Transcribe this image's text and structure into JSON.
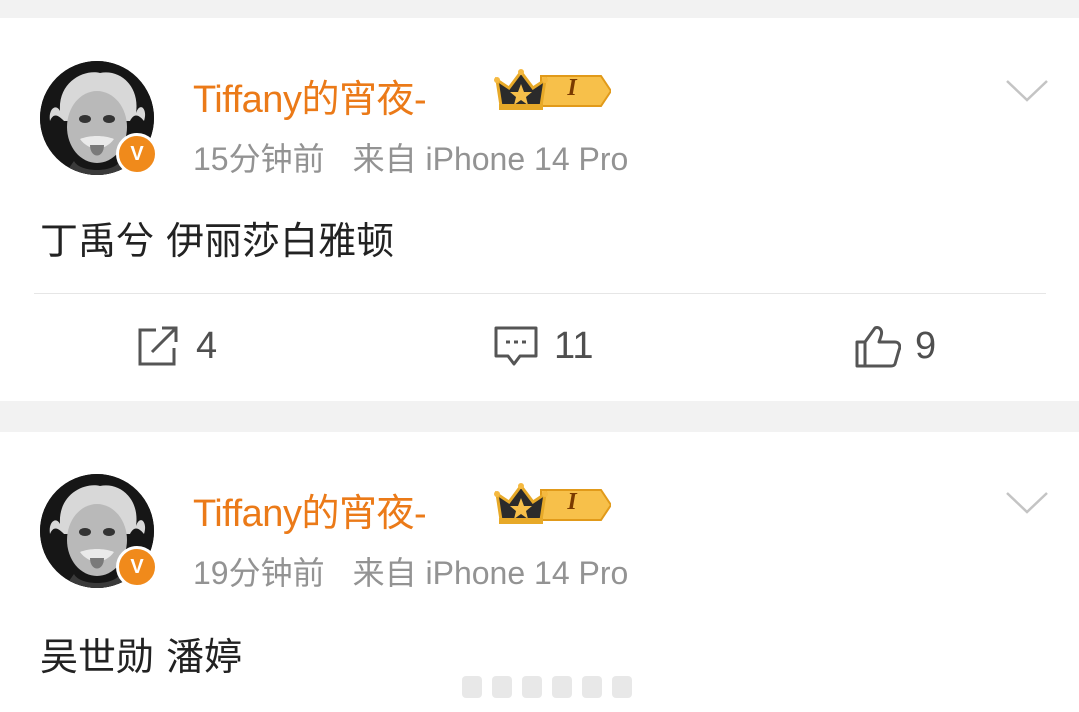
{
  "posts": [
    {
      "username": "Tiffany的宵夜-",
      "level_badge": "I",
      "verified_badge": "V",
      "time": "15分钟前",
      "source": "来自 iPhone 14 Pro",
      "content": "丁禹兮 伊丽莎白雅顿",
      "actions": {
        "repost": "4",
        "comment": "11",
        "like": "9"
      }
    },
    {
      "username": "Tiffany的宵夜-",
      "level_badge": "I",
      "verified_badge": "V",
      "time": "19分钟前",
      "source": "来自 iPhone 14 Pro",
      "content": "吴世勋 潘婷"
    }
  ],
  "colors": {
    "username": "#eb7a18",
    "meta": "#939393",
    "badge": "#f08a1b",
    "background": "#f2f2f2"
  },
  "icons": [
    "chevron-down-icon",
    "repost-icon",
    "comment-icon",
    "like-icon",
    "crown-icon",
    "verified-icon"
  ]
}
